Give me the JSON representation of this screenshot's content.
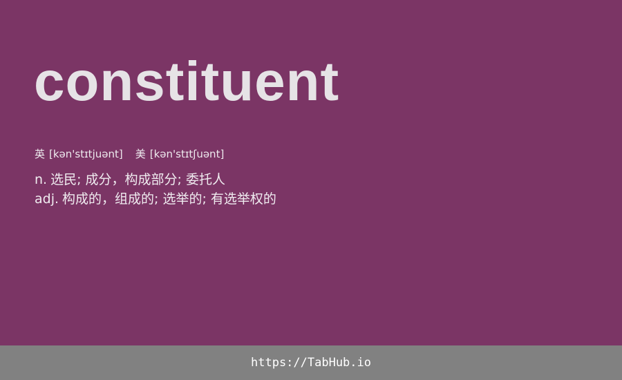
{
  "word": "constituent",
  "phonetics": {
    "uk_label": "英",
    "uk": "[kən'stɪtjuənt]",
    "us_label": "美",
    "us": "[kən'stɪtʃuənt]"
  },
  "definitions": [
    {
      "pos": "n.",
      "meaning": "选民; 成分，构成部分; 委托人"
    },
    {
      "pos": "adj.",
      "meaning": "构成的，组成的; 选举的; 有选举权的"
    }
  ],
  "footer": {
    "link": "https://TabHub.io"
  },
  "colors": {
    "background": "#7b3565",
    "footer": "#818181",
    "text": "#e6e3e6"
  }
}
